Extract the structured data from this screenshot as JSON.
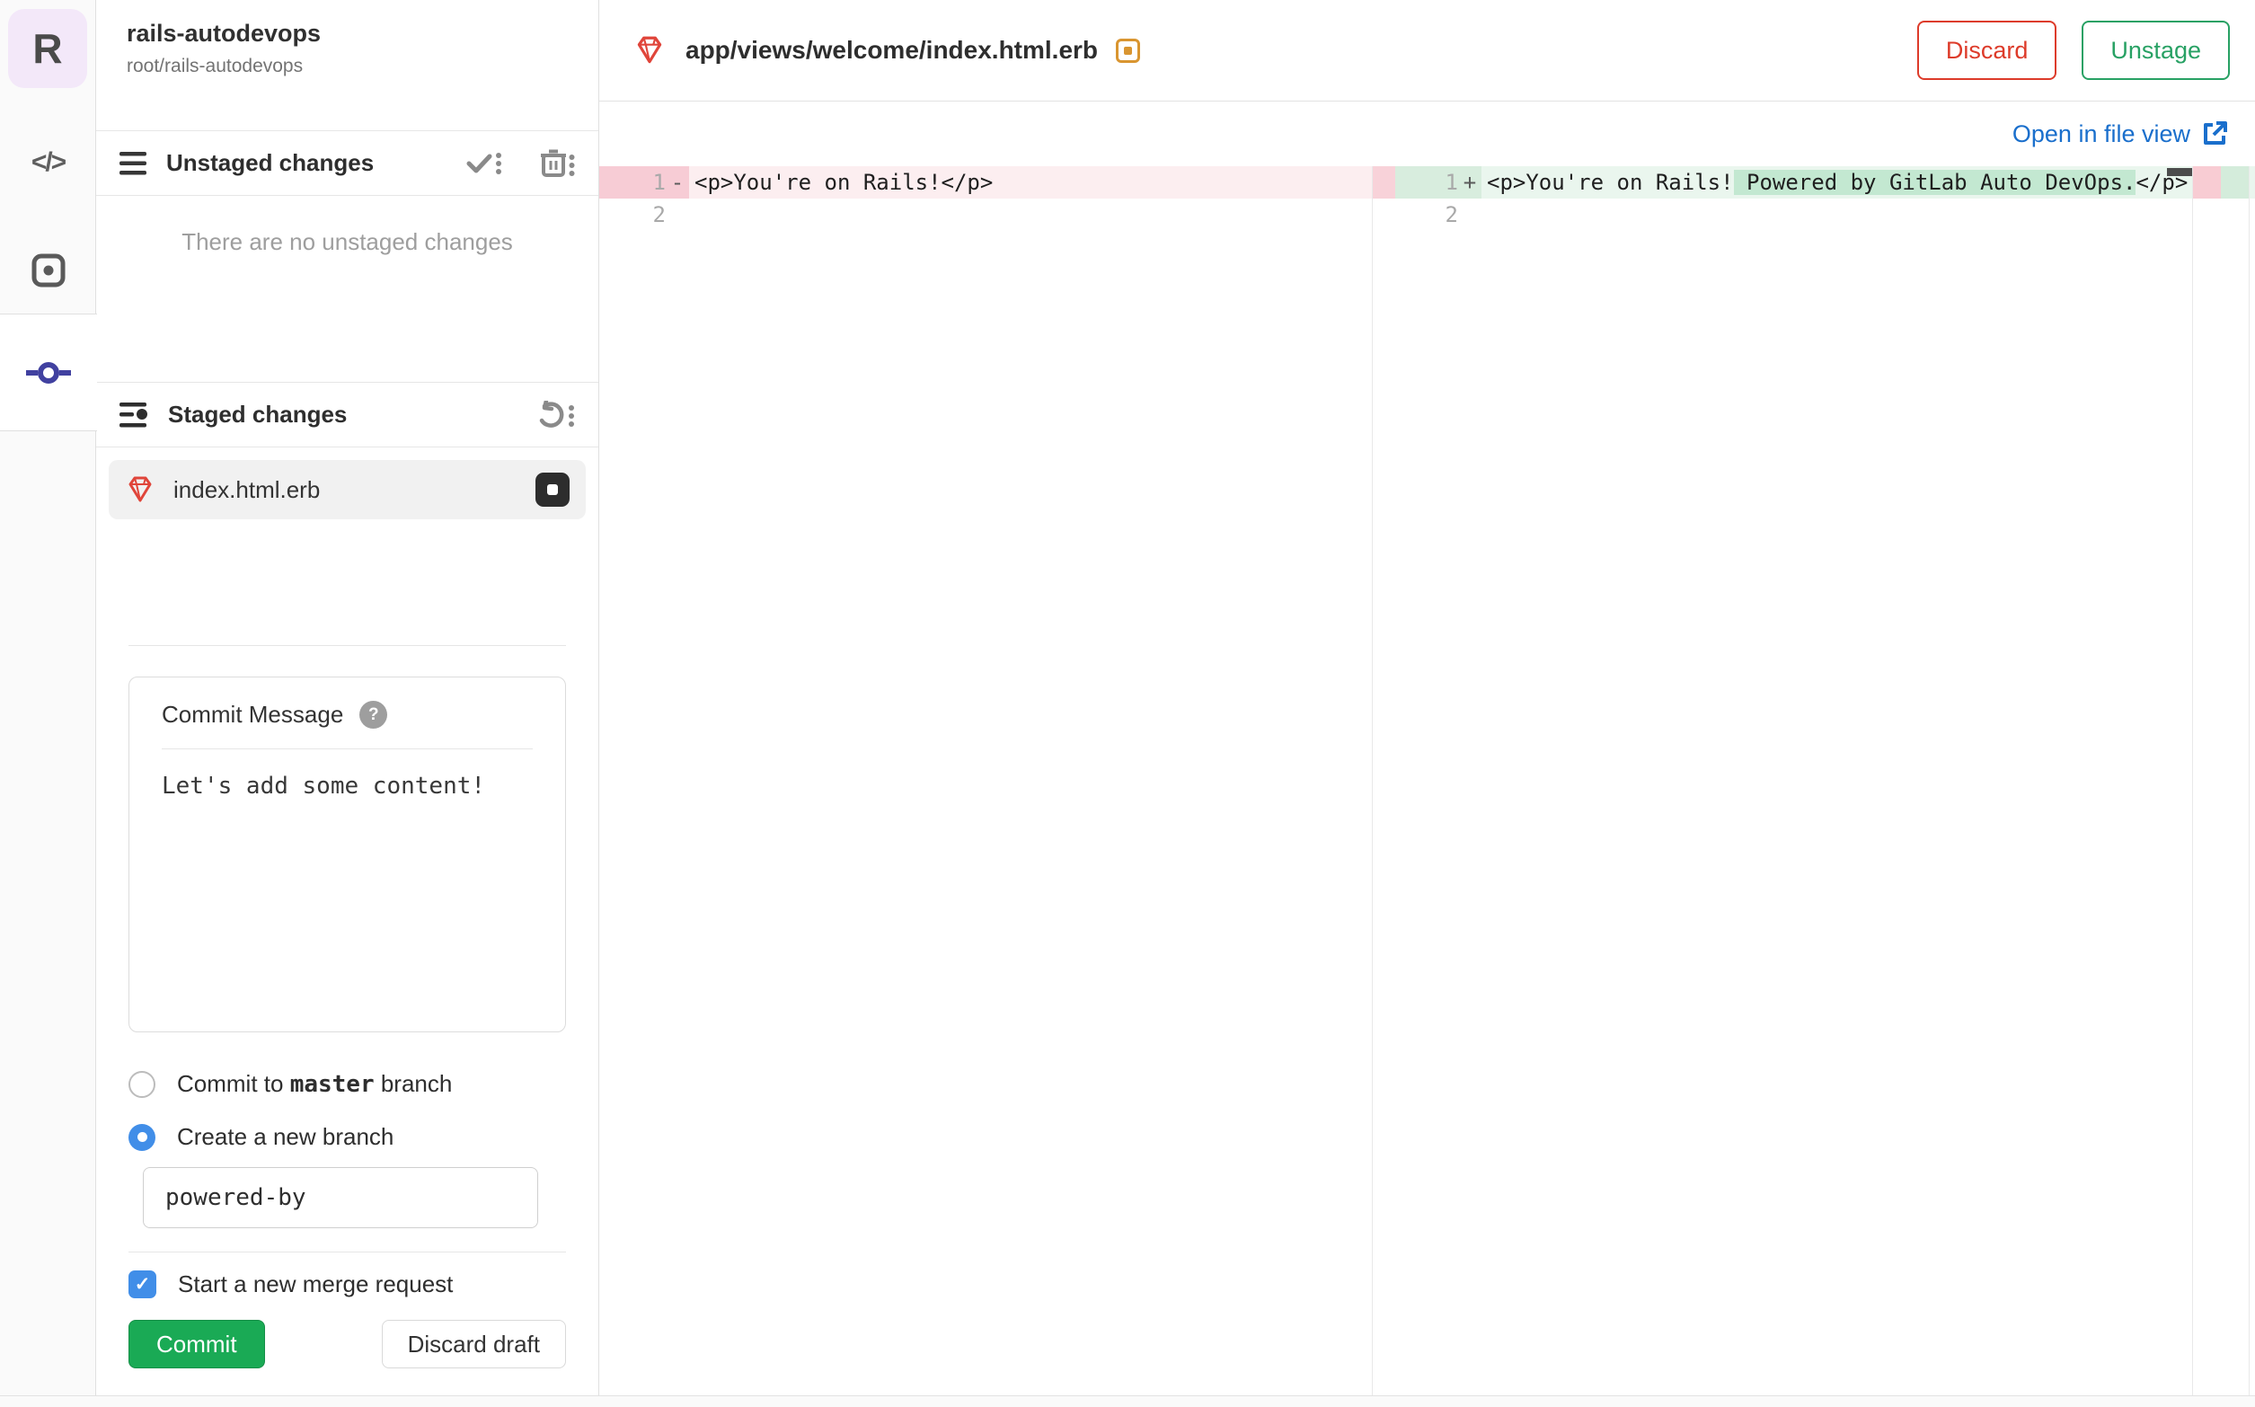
{
  "colors": {
    "accent_indigo": "#4141a0",
    "commit_green": "#1aaa55",
    "unstage_green": "#28a164",
    "discard_red": "#dd3b2a",
    "link_blue": "#1a6fcc",
    "control_blue": "#418ee8",
    "modified_orange": "#d99530",
    "removed_line_bg": "#fceef0",
    "removed_gutter_bg": "#f7ccd5",
    "added_line_bg": "#eaf6ee",
    "added_gutter_bg": "#d8edde",
    "added_word_bg": "#c3e8d1"
  },
  "rail": {
    "avatar_letter": "R",
    "code_glyph": "</>"
  },
  "project": {
    "name": "rails-autodevops",
    "path": "root/rails-autodevops"
  },
  "panel": {
    "unstaged": {
      "title": "Unstaged changes",
      "empty": "There are no unstaged changes"
    },
    "staged": {
      "title": "Staged changes",
      "file": {
        "name": "index.html.erb"
      }
    },
    "form": {
      "label": "Commit Message",
      "help_glyph": "?",
      "message": "Let's add some content!",
      "radio_master_prefix": "Commit to ",
      "radio_master_branch": "master",
      "radio_master_suffix": " branch",
      "radio_new_branch": "Create a new branch",
      "branch_input_value": "powered-by",
      "mr_checkbox": "Start a new merge request",
      "check_glyph": "✓",
      "commit": "Commit",
      "discard_draft": "Discard draft"
    }
  },
  "editor": {
    "file_path": "app/views/welcome/index.html.erb",
    "discard": "Discard",
    "unstage": "Unstage",
    "open_link": "Open in file view",
    "left": {
      "l1_num": "1",
      "l1_sign": "-",
      "l1_code": "<p>You're on Rails!</p>",
      "l2_num": "2"
    },
    "right": {
      "l1_num": "1",
      "l1_sign": "+",
      "l1_pre": "<p>You're on Rails!",
      "l1_ins": " Powered by GitLab Auto DevOps.",
      "l1_post": "</p>",
      "l2_num": "2"
    }
  }
}
